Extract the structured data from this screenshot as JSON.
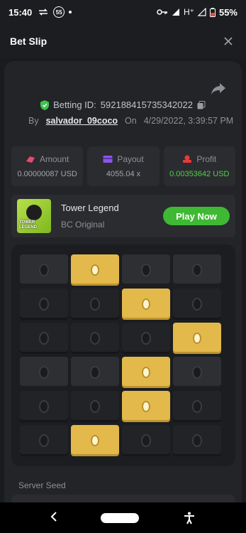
{
  "status_bar": {
    "time": "15:40",
    "notif_badge": "55",
    "network": "H⁺",
    "battery": "55%"
  },
  "header": {
    "title": "Bet Slip"
  },
  "bet": {
    "betting_id_label": "Betting ID:",
    "betting_id": "592188415735342022",
    "by_label": "By",
    "user": "salvador_09coco",
    "on_label": "On",
    "datetime": "4/29/2022, 3:39:57 PM"
  },
  "stats": [
    {
      "label": "Amount",
      "value": "0.00000087 USD",
      "icon": "amount-icon",
      "color": "#e84a6b"
    },
    {
      "label": "Payout",
      "value": "4055.04 x",
      "icon": "payout-icon",
      "color": "#8b56e8"
    },
    {
      "label": "Profit",
      "value": "0.00353642 USD",
      "icon": "profit-icon",
      "color": "#e83a3a"
    }
  ],
  "game": {
    "name": "Tower Legend",
    "subtitle": "BC Original",
    "play_label": "Play Now",
    "thumb_text": "TOWER LEGEND"
  },
  "grid": {
    "rows": [
      [
        "light",
        "gold",
        "light",
        "light"
      ],
      [
        "dark",
        "dark",
        "gold",
        "dark"
      ],
      [
        "dark",
        "dark",
        "dark",
        "gold"
      ],
      [
        "light",
        "light",
        "gold",
        "light"
      ],
      [
        "dark",
        "dark",
        "gold",
        "dark"
      ],
      [
        "dark",
        "gold",
        "dark",
        "dark"
      ]
    ]
  },
  "server_seed_label": "Server Seed",
  "colors": {
    "accent_green": "#3fb834",
    "profit_green": "#4fd146",
    "gold_tile": "#e2b94a",
    "background": "#232427"
  }
}
